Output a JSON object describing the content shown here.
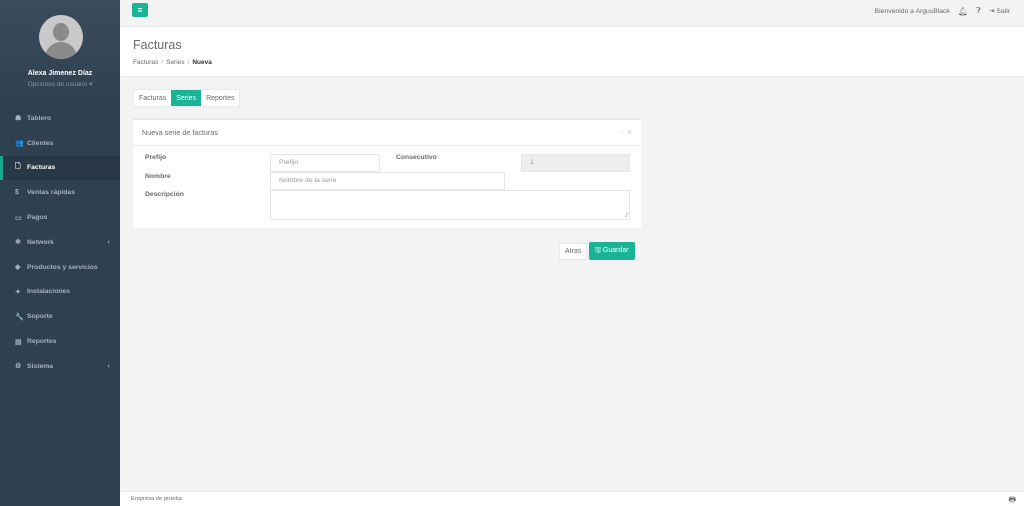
{
  "user": {
    "name": "Alexa Jimenez Díaz",
    "options": "Opciones de usuario ▾"
  },
  "nav": [
    {
      "icon": "☗",
      "label": "Tablero"
    },
    {
      "icon": "👥",
      "label": "Clientes"
    },
    {
      "icon": "🗋",
      "label": "Facturas"
    },
    {
      "icon": "$",
      "label": "Ventas rápidas"
    },
    {
      "icon": "▭",
      "label": "Pagos"
    },
    {
      "icon": "❄",
      "label": "Network",
      "arrow": "‹"
    },
    {
      "icon": "◆",
      "label": "Productos y servicios"
    },
    {
      "icon": "✦",
      "label": "Instalaciones"
    },
    {
      "icon": "🔧",
      "label": "Soporte"
    },
    {
      "icon": "▤",
      "label": "Reportes"
    },
    {
      "icon": "⚙",
      "label": "Sistema",
      "arrow": "‹"
    }
  ],
  "topbar": {
    "menu_icon": "≡",
    "welcome": "Bienvenido a ArgusBlack",
    "logout": "Salir"
  },
  "header": {
    "title": "Facturas",
    "crumb1": "Facturas",
    "crumb2": "Series",
    "crumb3": "Nueva"
  },
  "tabs": [
    "Facturas",
    "Series",
    "Reportes"
  ],
  "panel": {
    "title": "Nueva serie de facturas",
    "prefijo_label": "Prefijo",
    "prefijo_placeholder": "Prefijo",
    "consecutivo_label": "Consecutivo",
    "consecutivo_value": "1",
    "nombre_label": "Nombre",
    "nombre_placeholder": "Nombre de la serie",
    "descripcion_label": "Descripción"
  },
  "buttons": {
    "back": "Atras",
    "save": "Guardar"
  },
  "footer": {
    "company": "Empresa de prueba"
  },
  "colors": {
    "sidebar": "#2f4050",
    "accent": "#1ab394",
    "active_nav": "#293846"
  }
}
